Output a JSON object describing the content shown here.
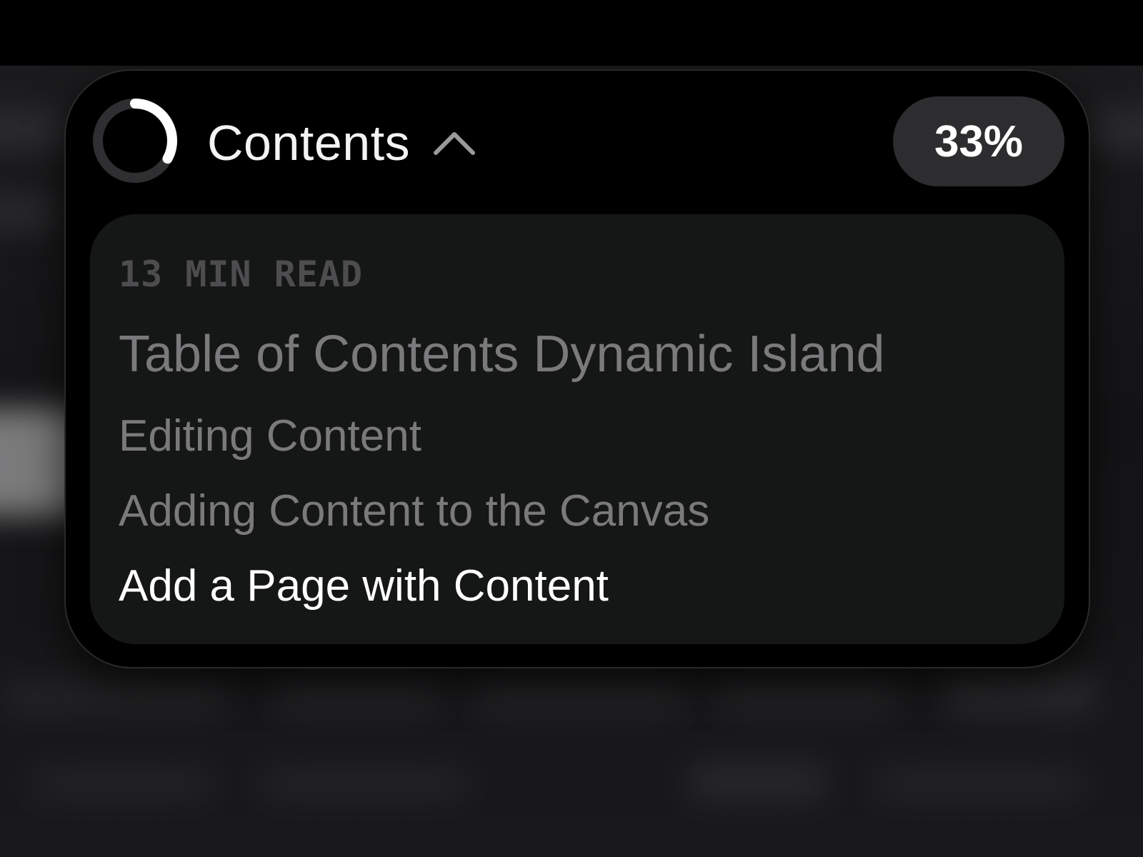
{
  "header": {
    "title": "Contents",
    "progress_percent_label": "33%",
    "progress_fraction": 0.33
  },
  "panel": {
    "read_time": "13 MIN READ",
    "items": [
      {
        "label": "Table of Contents Dynamic Island",
        "level": 1,
        "active": false
      },
      {
        "label": "Editing Content",
        "level": 2,
        "active": false
      },
      {
        "label": "Adding Content to the Canvas",
        "level": 2,
        "active": false
      },
      {
        "label": "Add a Page with Content",
        "level": 2,
        "active": true
      }
    ]
  },
  "colors": {
    "accent": "#ffffff",
    "ring_track": "#2f2f31",
    "muted_text": "#7a7a7c",
    "panel_bg": "#151616",
    "pill_bg": "#2d2d2f"
  },
  "icons": {
    "progress": "progress-ring-icon",
    "toggle": "chevron-up-icon"
  }
}
